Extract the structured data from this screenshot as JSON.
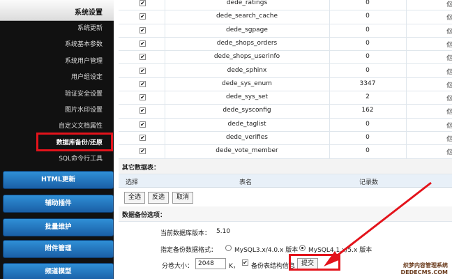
{
  "sidebar": {
    "section_title": "系统设置",
    "links": [
      "系统更新",
      "系统基本参数",
      "系统用户管理",
      "用户组设定",
      "验证安全设置",
      "图片水印设置",
      "自定义文档属性",
      "数据库备份/还原",
      "SQL命令行工具"
    ],
    "buttons": [
      "HTML更新",
      "辅助插件",
      "批量维护",
      "附件管理",
      "频道模型"
    ]
  },
  "table": {
    "rows": [
      {
        "name": "dede_ratings",
        "count": "0"
      },
      {
        "name": "dede_search_cache",
        "count": "0"
      },
      {
        "name": "dede_sgpage",
        "count": "0"
      },
      {
        "name": "dede_shops_orders",
        "count": "0"
      },
      {
        "name": "dede_shops_userinfo",
        "count": "0"
      },
      {
        "name": "dede_sphinx",
        "count": "0"
      },
      {
        "name": "dede_sys_enum",
        "count": "3347"
      },
      {
        "name": "dede_sys_set",
        "count": "2"
      },
      {
        "name": "dede_sysconfig",
        "count": "162"
      },
      {
        "name": "dede_taglist",
        "count": "0"
      },
      {
        "name": "dede_verifies",
        "count": "0"
      },
      {
        "name": "dede_vote_member",
        "count": "0"
      }
    ],
    "edge_text": "伛",
    "check_mark": "✔"
  },
  "other": {
    "title": "其它数据表：",
    "col_select": "选择",
    "col_name": "表名",
    "col_count": "记录数"
  },
  "actions": {
    "select_all": "全选",
    "invert": "反选",
    "cancel": "取消"
  },
  "backup": {
    "title": "数据备份选项：",
    "db_version_label": "当前数据库版本：",
    "db_version": "5.10",
    "format_label": "指定备份数据格式：",
    "format_opt1": "MySQL3.x/4.0.x 版本",
    "format_opt2": "MySQL4.1.x/5.x 版本",
    "size_label": "分卷大小：",
    "size_value": "2048",
    "size_unit": "K，",
    "struct_label": "备份表结构信息",
    "submit": "提交"
  },
  "watermark": {
    "line1": "织梦内容管理系统",
    "line2": "DEDECMS.COM"
  },
  "colors": {
    "highlight": "#e3131b",
    "side_btn": "#1a5fa6"
  }
}
